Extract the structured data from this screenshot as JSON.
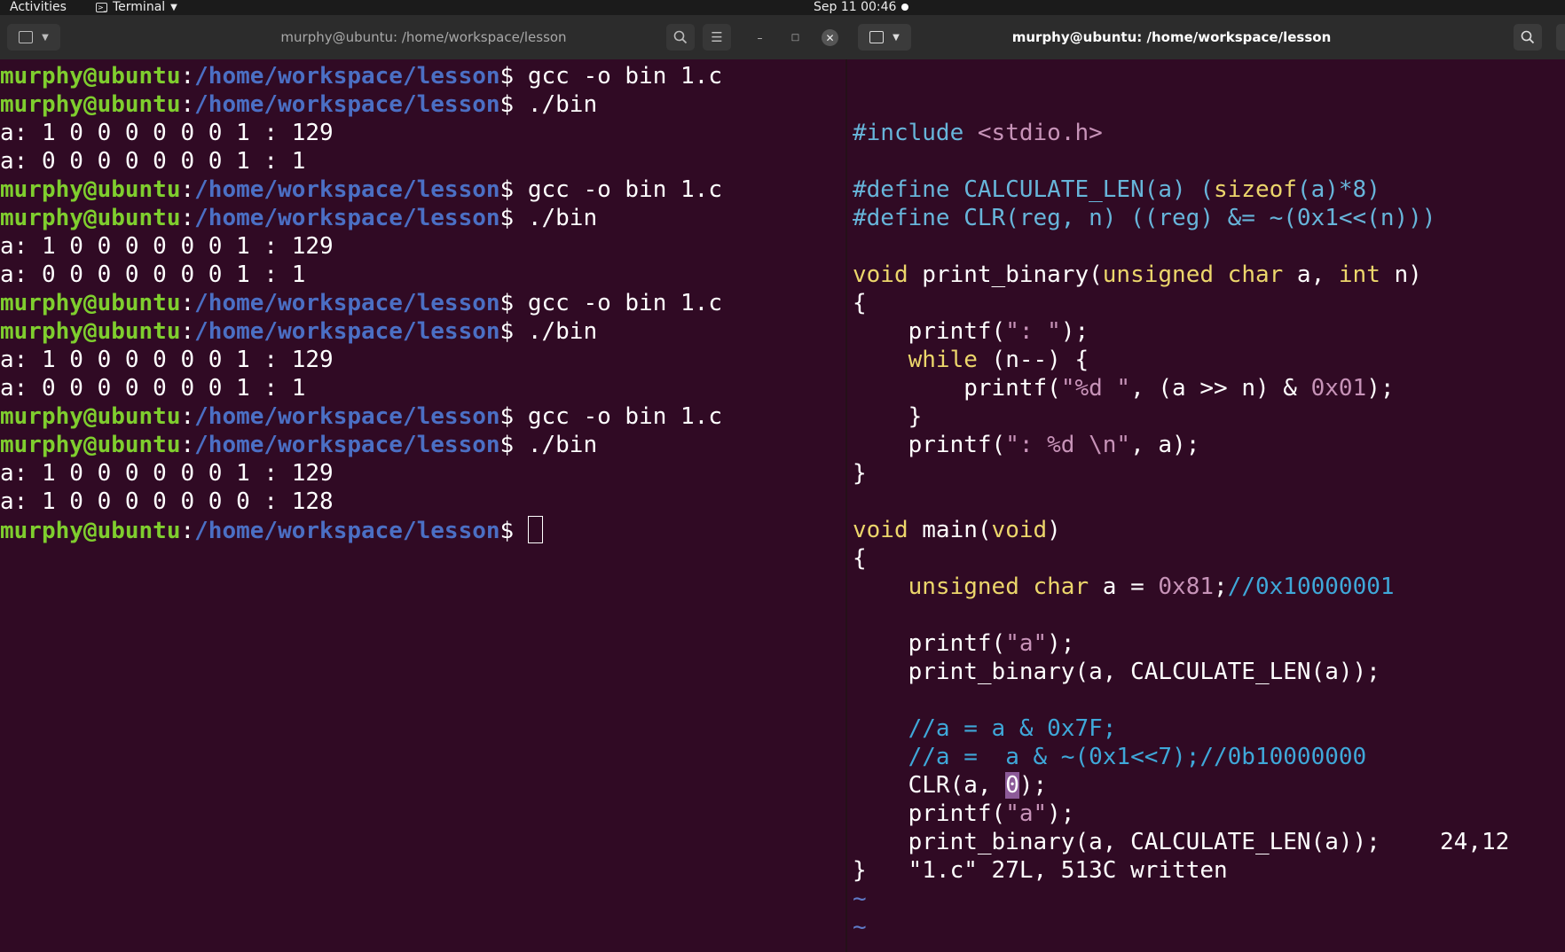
{
  "topbar": {
    "activities": "Activities",
    "app_name": "Terminal",
    "app_menu_icon": "caret-down-icon",
    "clock": "Sep 11  00:46"
  },
  "left_window": {
    "title": "murphy@ubuntu: /home/workspace/lesson",
    "icons": [
      "new-tab-icon",
      "dropdown-icon",
      "search-icon",
      "hamburger-menu-icon",
      "minimize-icon",
      "maximize-icon",
      "close-icon"
    ]
  },
  "right_window": {
    "title": "murphy@ubuntu: /home/workspace/lesson",
    "icons": [
      "new-tab-icon",
      "dropdown-icon",
      "search-icon"
    ]
  },
  "shell": {
    "user": "murphy@ubuntu",
    "sep": ":",
    "path": "/home/workspace/lesson",
    "prompt_char": "$ ",
    "lines": [
      {
        "type": "prompt",
        "cmd": "gcc -o bin 1.c"
      },
      {
        "type": "prompt",
        "cmd": "./bin"
      },
      {
        "type": "out",
        "text": "a: 1 0 0 0 0 0 0 1 : 129"
      },
      {
        "type": "out",
        "text": "a: 0 0 0 0 0 0 0 1 : 1"
      },
      {
        "type": "prompt",
        "cmd": "gcc -o bin 1.c"
      },
      {
        "type": "prompt",
        "cmd": "./bin"
      },
      {
        "type": "out",
        "text": "a: 1 0 0 0 0 0 0 1 : 129"
      },
      {
        "type": "out",
        "text": "a: 0 0 0 0 0 0 0 1 : 1"
      },
      {
        "type": "prompt",
        "cmd": "gcc -o bin 1.c"
      },
      {
        "type": "prompt",
        "cmd": "./bin"
      },
      {
        "type": "out",
        "text": "a: 1 0 0 0 0 0 0 1 : 129"
      },
      {
        "type": "out",
        "text": "a: 0 0 0 0 0 0 0 1 : 1"
      },
      {
        "type": "prompt",
        "cmd": "gcc -o bin 1.c"
      },
      {
        "type": "prompt",
        "cmd": "./bin"
      },
      {
        "type": "out",
        "text": "a: 1 0 0 0 0 0 0 1 : 129"
      },
      {
        "type": "out",
        "text": "a: 1 0 0 0 0 0 0 0 : 128"
      },
      {
        "type": "prompt",
        "cmd": "",
        "cursor": true
      }
    ]
  },
  "vim": {
    "lines": [
      [
        {
          "c": "pre",
          "t": "#include "
        },
        {
          "c": "str",
          "t": "<stdio.h>"
        }
      ],
      [],
      [
        {
          "c": "pre",
          "t": "#define CALCULATE_LEN(a) ("
        },
        {
          "c": "typ",
          "t": "sizeof"
        },
        {
          "c": "pre",
          "t": "(a)*8)"
        }
      ],
      [
        {
          "c": "pre",
          "t": "#define CLR(reg, n) ((reg) &= ~(0x1<<(n)))"
        }
      ],
      [],
      [
        {
          "c": "typ",
          "t": "void"
        },
        {
          "c": "",
          "t": " print_binary("
        },
        {
          "c": "typ",
          "t": "unsigned char"
        },
        {
          "c": "",
          "t": " a, "
        },
        {
          "c": "typ",
          "t": "int"
        },
        {
          "c": "",
          "t": " n)"
        }
      ],
      [
        {
          "c": "",
          "t": "{"
        }
      ],
      [
        {
          "c": "",
          "t": "    printf("
        },
        {
          "c": "str",
          "t": "\": \""
        },
        {
          "c": "",
          "t": ");"
        }
      ],
      [
        {
          "c": "",
          "t": "    "
        },
        {
          "c": "typ",
          "t": "while"
        },
        {
          "c": "",
          "t": " (n--) {"
        }
      ],
      [
        {
          "c": "",
          "t": "        printf("
        },
        {
          "c": "str",
          "t": "\"%d \""
        },
        {
          "c": "",
          "t": ", (a >> n) & "
        },
        {
          "c": "num",
          "t": "0x01"
        },
        {
          "c": "",
          "t": ");"
        }
      ],
      [
        {
          "c": "",
          "t": "    }"
        }
      ],
      [
        {
          "c": "",
          "t": "    printf("
        },
        {
          "c": "str",
          "t": "\": %d \\n\""
        },
        {
          "c": "",
          "t": ", a);"
        }
      ],
      [
        {
          "c": "",
          "t": "}"
        }
      ],
      [],
      [
        {
          "c": "typ",
          "t": "void"
        },
        {
          "c": "",
          "t": " main("
        },
        {
          "c": "typ",
          "t": "void"
        },
        {
          "c": "",
          "t": ")"
        }
      ],
      [
        {
          "c": "",
          "t": "{"
        }
      ],
      [
        {
          "c": "",
          "t": "    "
        },
        {
          "c": "typ",
          "t": "unsigned char"
        },
        {
          "c": "",
          "t": " a = "
        },
        {
          "c": "num",
          "t": "0x81"
        },
        {
          "c": "",
          "t": ";"
        },
        {
          "c": "cmt",
          "t": "//0x10000001"
        }
      ],
      [],
      [
        {
          "c": "",
          "t": "    printf("
        },
        {
          "c": "str",
          "t": "\"a\""
        },
        {
          "c": "",
          "t": ");"
        }
      ],
      [
        {
          "c": "",
          "t": "    print_binary(a, CALCULATE_LEN(a));"
        }
      ],
      [],
      [
        {
          "c": "",
          "t": "    "
        },
        {
          "c": "cmt",
          "t": "//a = a & 0x7F;"
        }
      ],
      [
        {
          "c": "",
          "t": "    "
        },
        {
          "c": "cmt",
          "t": "//a =  a & ~(0x1<<7);//0b10000000"
        }
      ],
      [
        {
          "c": "",
          "t": "    CLR(a, "
        },
        {
          "c": "hl",
          "t": "0"
        },
        {
          "c": "",
          "t": ");"
        }
      ],
      [
        {
          "c": "",
          "t": "    printf("
        },
        {
          "c": "str",
          "t": "\"a\""
        },
        {
          "c": "",
          "t": ");"
        }
      ],
      [
        {
          "c": "",
          "t": "    print_binary(a, CALCULATE_LEN(a));"
        }
      ],
      [
        {
          "c": "",
          "t": "}"
        }
      ],
      [
        {
          "c": "tilde",
          "t": "~"
        }
      ],
      [
        {
          "c": "tilde",
          "t": "~"
        }
      ],
      [
        {
          "c": "tilde",
          "t": "~"
        }
      ]
    ],
    "status_message": "\"1.c\" 27L, 513C written",
    "cursor_position": "24,12"
  }
}
